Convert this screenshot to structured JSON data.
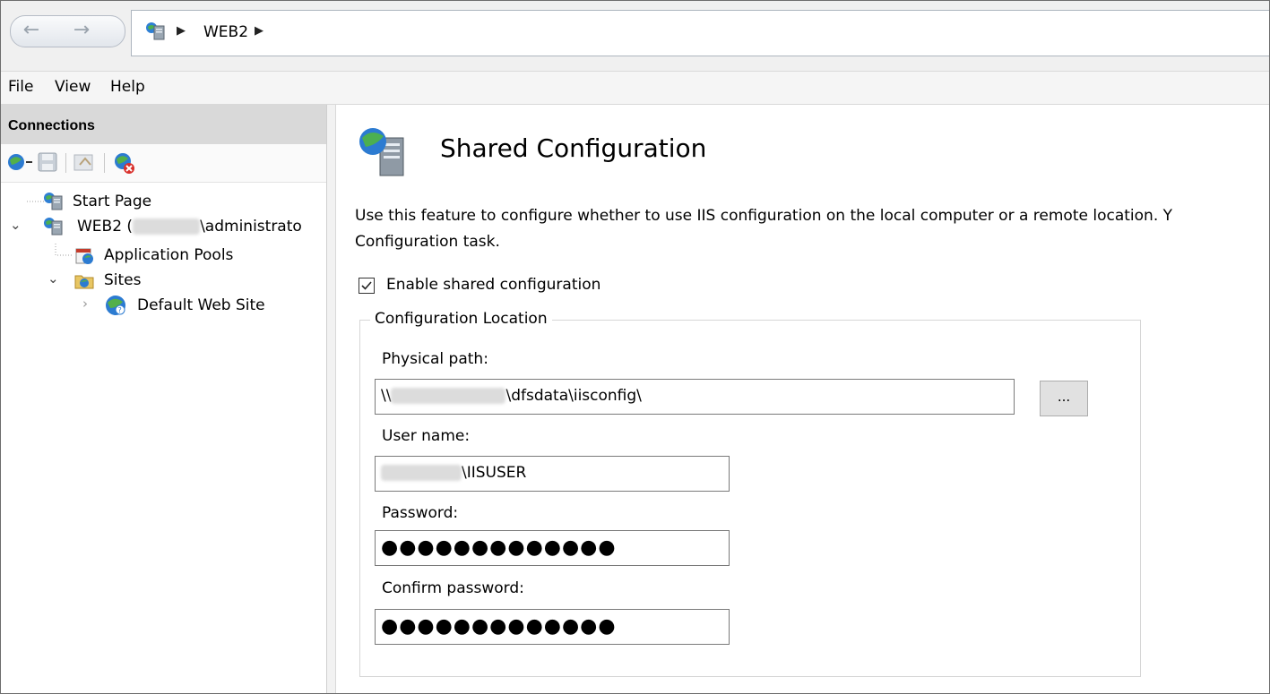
{
  "address": {
    "back_glyph": "←",
    "forward_glyph": "→",
    "separator": "▶",
    "breadcrumb": [
      "WEB2"
    ]
  },
  "menu": [
    "File",
    "View",
    "Help"
  ],
  "connections": {
    "title": "Connections",
    "tree": [
      {
        "label": "Start Page",
        "icon": "server-home-icon"
      },
      {
        "label_prefix": "WEB2 (",
        "label_suffix": "\\administrato",
        "icon": "server-icon",
        "expanded": true
      },
      {
        "label": "Application Pools",
        "icon": "app-pool-icon"
      },
      {
        "label": "Sites",
        "icon": "folder-icon",
        "expanded": true
      },
      {
        "label": "Default Web Site",
        "icon": "website-globe-icon",
        "expanded": false
      }
    ]
  },
  "main": {
    "title": "Shared Configuration",
    "description_line1": "Use this feature to configure whether to use IIS configuration on the local computer or a remote location. Y",
    "description_line2": "Configuration task.",
    "enable_checkbox": {
      "label": "Enable shared configuration",
      "checked": true
    },
    "group_title": "Configuration Location",
    "physical_path": {
      "label": "Physical path:",
      "prefix": "\\\\",
      "suffix": "\\dfsdata\\iisconfig\\",
      "browse_label": "..."
    },
    "user_name": {
      "label": "User name:",
      "suffix": "\\IISUSER"
    },
    "password": {
      "label": "Password:",
      "masked": "●●●●●●●●●●●●●"
    },
    "confirm_password": {
      "label": "Confirm password:",
      "masked": "●●●●●●●●●●●●●"
    }
  }
}
